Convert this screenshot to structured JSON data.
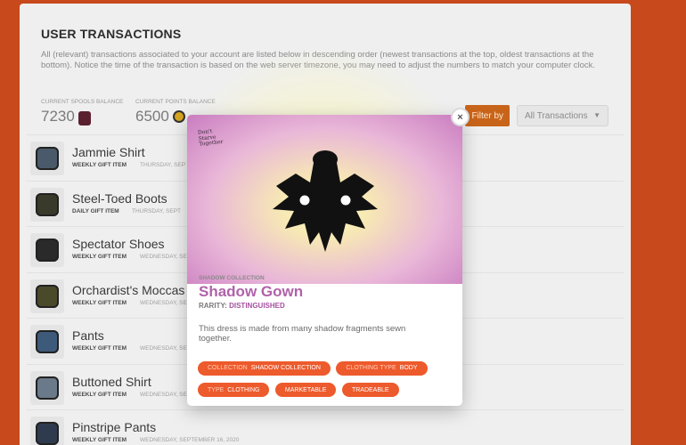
{
  "page": {
    "title": "USER TRANSACTIONS",
    "description": "All (relevant) transactions associated to your account are listed below in descending order (newest transactions at the top, oldest transactions at the bottom). Notice the time of the transaction is based on the web server timezone, you may need to adjust the numbers to match your computer clock."
  },
  "balances": {
    "spools_label": "CURRENT SPOOLS BALANCE",
    "spools_value": "7230",
    "points_label": "CURRENT POINTS BALANCE",
    "points_value": "6500"
  },
  "filter": {
    "label": "Filter by",
    "selected": "All Transactions"
  },
  "transactions": [
    {
      "name": "Jammie Shirt",
      "kind": "WEEKLY GIFT ITEM",
      "date": "THURSDAY, SEP"
    },
    {
      "name": "Steel-Toed Boots",
      "kind": "DAILY GIFT ITEM",
      "date": "THURSDAY, SEPT"
    },
    {
      "name": "Spectator Shoes",
      "kind": "WEEKLY GIFT ITEM",
      "date": "WEDNESDAY, SE"
    },
    {
      "name": "Orchardist's Moccas",
      "kind": "WEEKLY GIFT ITEM",
      "date": "WEDNESDAY, SE"
    },
    {
      "name": "Pants",
      "kind": "WEEKLY GIFT ITEM",
      "date": "WEDNESDAY, SE"
    },
    {
      "name": "Buttoned Shirt",
      "kind": "WEEKLY GIFT ITEM",
      "date": "WEDNESDAY, SE"
    },
    {
      "name": "Pinstripe Pants",
      "kind": "WEEKLY GIFT ITEM",
      "date": "WEDNESDAY, SEPTEMBER 16, 2020"
    }
  ],
  "modal": {
    "logo_text": "Don't Starve Together",
    "collection": "SHADOW COLLECTION",
    "item_name": "Shadow Gown",
    "rarity_label": "RARITY:",
    "rarity_value": "DISTINGUISHED",
    "description": "This dress is made from many shadow fragments sewn together.",
    "close_label": "×",
    "tags": [
      {
        "key": "COLLECTION",
        "value": "SHADOW COLLECTION"
      },
      {
        "key": "CLOTHING TYPE",
        "value": "BODY"
      },
      {
        "key": "TYPE",
        "value": "CLOTHING"
      },
      {
        "key": "",
        "value": "MARKETABLE"
      },
      {
        "key": "",
        "value": "TRADEABLE"
      }
    ]
  },
  "colors": {
    "background": "#c8491b",
    "accent": "#ed5a2c",
    "rarity": "#b062a9"
  }
}
